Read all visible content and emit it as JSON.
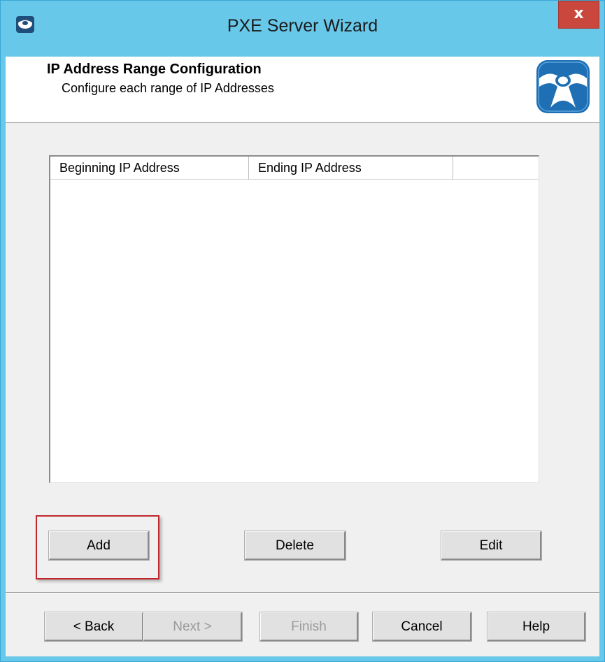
{
  "window": {
    "title": "PXE Server Wizard",
    "close_glyph": "x",
    "icon": "thinmanager-icon"
  },
  "header": {
    "title": "IP Address Range Configuration",
    "subtitle": "Configure each range of IP Addresses",
    "logo": "thinmanager-logo"
  },
  "list": {
    "columns": [
      "Beginning IP Address",
      "Ending IP Address",
      ""
    ],
    "rows": []
  },
  "range_buttons": {
    "add": "Add",
    "delete": "Delete",
    "edit": "Edit"
  },
  "nav_buttons": {
    "back": "< Back",
    "next": "Next >",
    "finish": "Finish",
    "cancel": "Cancel",
    "help": "Help"
  },
  "colors": {
    "titlebar": "#68c8ea",
    "close": "#c9473c",
    "highlight": "#c0282d",
    "logo_blue": "#1e6fb3"
  }
}
